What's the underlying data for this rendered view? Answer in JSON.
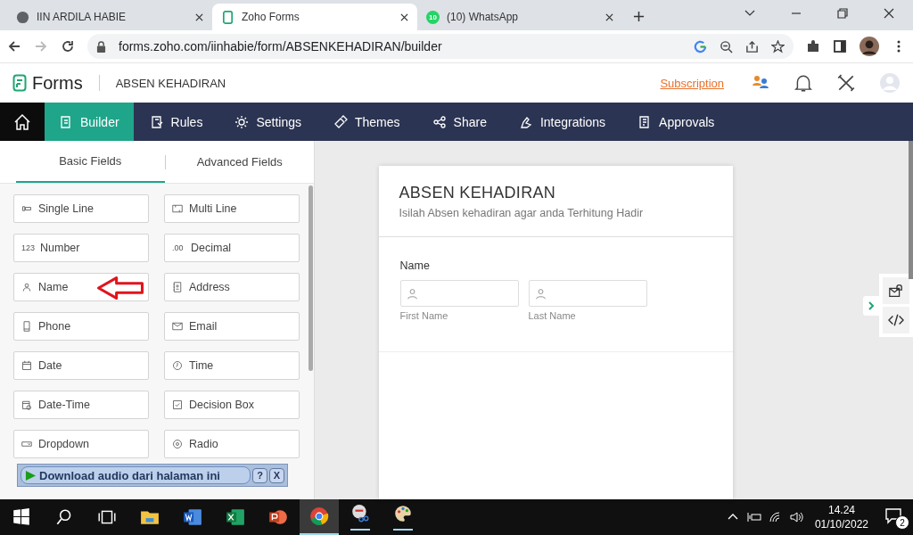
{
  "browser_tabs": [
    {
      "title": "IIN ARDILA HABIE",
      "selected": false
    },
    {
      "title": "Zoho Forms",
      "selected": true
    },
    {
      "title": "(10) WhatsApp",
      "selected": false,
      "badge": "10"
    }
  ],
  "address_bar": {
    "url": "forms.zoho.com/iinhabie/form/ABSENKEHADIRAN/builder"
  },
  "app_header": {
    "logo": "Forms",
    "form_name": "ABSEN KEHADIRAN",
    "subscription_link": "Subscription"
  },
  "nav": [
    {
      "label": "Builder",
      "selected": true
    },
    {
      "label": "Rules",
      "selected": false
    },
    {
      "label": "Settings",
      "selected": false
    },
    {
      "label": "Themes",
      "selected": false
    },
    {
      "label": "Share",
      "selected": false
    },
    {
      "label": "Integrations",
      "selected": false
    },
    {
      "label": "Approvals",
      "selected": false
    }
  ],
  "panel_tabs": [
    {
      "label": "Basic Fields",
      "selected": true
    },
    {
      "label": "Advanced Fields",
      "selected": false
    }
  ],
  "fields": [
    {
      "label": "Single Line",
      "annotated": false
    },
    {
      "label": "Multi Line",
      "annotated": false
    },
    {
      "label": "Number",
      "icon_text": "123",
      "annotated": false
    },
    {
      "label": "Decimal",
      "icon_text": ".00",
      "annotated": false
    },
    {
      "label": "Name",
      "annotated": true
    },
    {
      "label": "Address",
      "annotated": false
    },
    {
      "label": "Phone",
      "annotated": false
    },
    {
      "label": "Email",
      "annotated": false
    },
    {
      "label": "Date",
      "annotated": false
    },
    {
      "label": "Time",
      "annotated": false
    },
    {
      "label": "Date-Time",
      "annotated": false
    },
    {
      "label": "Decision Box",
      "annotated": false
    },
    {
      "label": "Dropdown",
      "annotated": false
    },
    {
      "label": "Radio",
      "annotated": false
    }
  ],
  "download_bar": {
    "label": "Download audio dari halaman ini",
    "help": "?",
    "close": "X"
  },
  "form": {
    "title": "ABSEN KEHADIRAN",
    "description": "Isilah Absen kehadiran agar anda Terhitung Hadir",
    "field_label": "Name",
    "subfields": [
      "First Name",
      "Last Name"
    ]
  },
  "taskbar": {
    "time": "14.24",
    "date": "01/10/2022",
    "notifications": "2"
  }
}
